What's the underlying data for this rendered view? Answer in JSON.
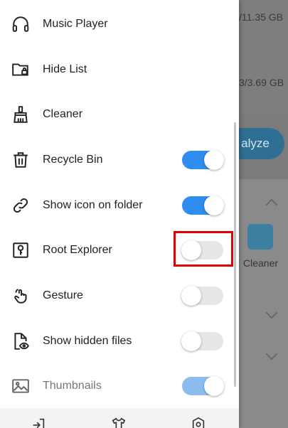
{
  "background": {
    "storage_1": "/11.35 GB",
    "storage_2": "3/3.69 GB",
    "analyze_label": "alyze",
    "cleaner_label": "Cleaner"
  },
  "drawer": {
    "items": [
      {
        "label": "Music Player",
        "icon": "headphones-icon"
      },
      {
        "label": "Hide List",
        "icon": "folder-lock-icon"
      },
      {
        "label": "Cleaner",
        "icon": "broom-icon"
      },
      {
        "label": "Recycle Bin",
        "icon": "trash-icon",
        "toggle": "on"
      },
      {
        "label": "Show icon on folder",
        "icon": "link-icon",
        "toggle": "on"
      },
      {
        "label": "Root Explorer",
        "icon": "key-icon",
        "toggle": "off"
      },
      {
        "label": "Gesture",
        "icon": "gesture-hand-icon",
        "toggle": "off"
      },
      {
        "label": "Show hidden files",
        "icon": "eye-file-icon",
        "toggle": "off"
      },
      {
        "label": "Thumbnails",
        "icon": "image-icon",
        "toggle": "on"
      }
    ]
  },
  "colors": {
    "toggle_on": "#2f8df0",
    "toggle_off": "#e6e6e6",
    "highlight": "#e00000"
  }
}
